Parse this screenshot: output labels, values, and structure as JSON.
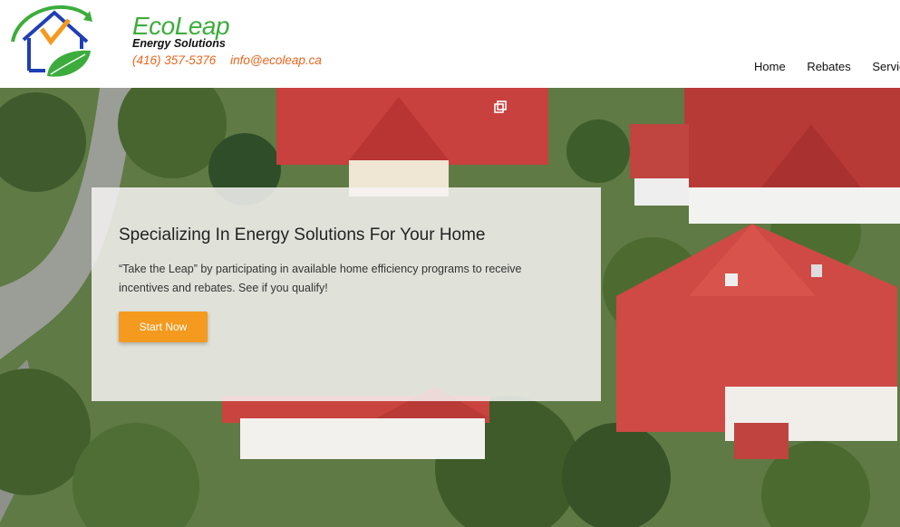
{
  "brand": {
    "name": "EcoLeap",
    "tagline": "Energy Solutions",
    "phone": "(416) 357-5376",
    "email": "info@ecoleap.ca"
  },
  "nav": {
    "items": [
      "Home",
      "Rebates",
      "Services"
    ]
  },
  "hero": {
    "title": "Specializing In Energy Solutions For Your Home",
    "text": "“Take the Leap” by participating in available home efficiency programs to receive incentives and rebates. See if you qualify!",
    "cta_label": "Start Now"
  },
  "colors": {
    "brand_green": "#3cad3c",
    "contact_orange": "#e8651c",
    "cta_orange": "#f39a1f",
    "roof_red": "#c8413e"
  },
  "icons": {
    "logo": "house-leaf-logo",
    "video": "video-expand-icon"
  }
}
